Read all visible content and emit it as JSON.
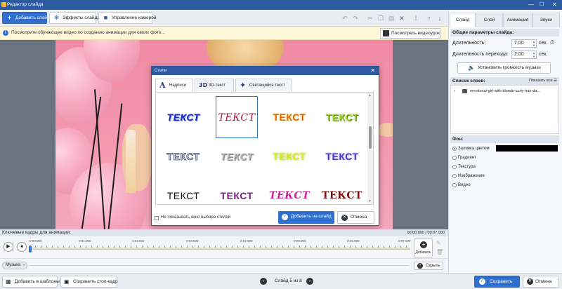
{
  "window": {
    "title": "Редактор слайда",
    "minimize": "—",
    "maximize": "☐",
    "close": "✕"
  },
  "toolbar": {
    "add_layer": "Добавить слой",
    "slide_effects": "Эффекты слайда",
    "camera": "Управление камерой"
  },
  "infobar": {
    "text": "Посмотрите обучающее видео по созданию анимации для своих фото...",
    "button": "Посмотреть видеоурок"
  },
  "dialog": {
    "title": "Стили",
    "tabs": [
      {
        "label": "Надписи",
        "icon": "A"
      },
      {
        "label": "3D-текст",
        "icon": "3D"
      },
      {
        "label": "Светящийся текст",
        "icon": "✦"
      }
    ],
    "style_items": [
      {
        "text": "ТЕКСТ",
        "color": "#1c2fb8",
        "style": "italic"
      },
      {
        "text": "ТЕКСТ",
        "color": "#b0163c",
        "style": "serif-italic"
      },
      {
        "text": "ТЕКСТ",
        "color": "#e26a0a",
        "style": "gradient-orange"
      },
      {
        "text": "ТЕКСТ",
        "color": "#9bd22c",
        "style": "green"
      },
      {
        "text": "ТЕКСТ",
        "color": "#c9d3e6",
        "style": "outline-grey"
      },
      {
        "text": "ТЕКСТ",
        "color": "#b9b9b9",
        "style": "shadow-grey"
      },
      {
        "text": "ТЕКСТ",
        "color": "#f0b418",
        "style": "yellow-glow"
      },
      {
        "text": "ТЕКСТ",
        "color": "#4a3ac8",
        "style": "blue-purple"
      },
      {
        "text": "ТЕКСТ",
        "color": "#111111",
        "style": "black"
      },
      {
        "text": "ТЕКСТ",
        "color": "#7a1e86",
        "style": "purple"
      },
      {
        "text": "ТЕКСТ",
        "color": "#d21ea0",
        "style": "pink-script"
      },
      {
        "text": "ТЕКСТ",
        "color": "#7a1010",
        "style": "dark-red"
      }
    ],
    "dont_show": "Не показывать окно выбора стилей",
    "add_button": "Добавить на слайд",
    "cancel_button": "Отмена"
  },
  "right_panel": {
    "tabs": [
      "Слайд",
      "Слой",
      "Анимация",
      "Звуки"
    ],
    "general_title": "Общие параметры слайда:",
    "duration_label": "Длительность:",
    "duration_value": "7,00",
    "sec": "сек.",
    "transition_label": "Длительность перехода:",
    "transition_value": "2,00",
    "music_volume": "Установить громкость музыки",
    "layers_title": "Список слоев:",
    "show_all": "Показать все",
    "layer_name": "emotional-girl-with-blonde-curly-hair-da...",
    "bg_title": "Фон:",
    "bg_options": [
      "Заливка цветом",
      "Градиент",
      "Текстура",
      "Изображение",
      "Видео"
    ],
    "fill_color": "#000000"
  },
  "keyframes": {
    "title": "Ключевые кадры для анимации:",
    "time": "00:00.000 / 00:07.000",
    "ticks": [
      "0:00.000",
      "0:01.000",
      "0:02.000",
      "0:03.000",
      "0:04.000",
      "0:05.000",
      "0:06.000",
      "0:07.000"
    ],
    "add": "Добавить",
    "hide": "Скрыть",
    "music": "Музыка"
  },
  "footer": {
    "add_template": "Добавить в шаблоны",
    "save_frame": "Сохранить стоп-кадр",
    "slide_counter": "Слайд 5 из 8",
    "save": "Сохранить",
    "cancel": "Отмена"
  },
  "colors": {
    "accent": "#2f6fce",
    "titlebar": "#2c5aa0",
    "photo_bg": "#f08aa5"
  }
}
